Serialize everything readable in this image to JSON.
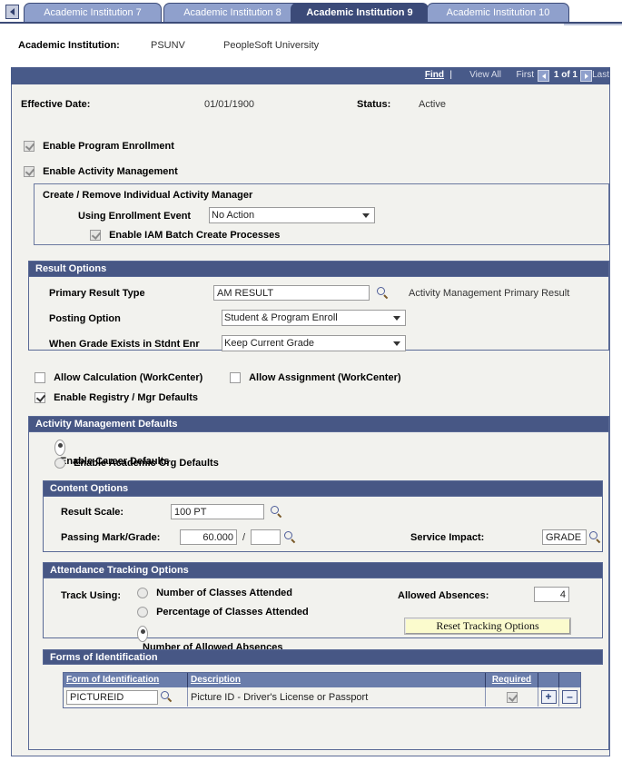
{
  "tabs": {
    "prev_icon": "left-arrow-icon",
    "items": [
      {
        "label": "Academic Institution 7",
        "active": false
      },
      {
        "label": "Academic Institution 8",
        "active": false
      },
      {
        "label": "Academic Institution 9",
        "active": true
      },
      {
        "label": "Academic Institution 10",
        "active": false
      }
    ]
  },
  "institution": {
    "label": "Academic Institution:",
    "code": "PSUNV",
    "name": "PeopleSoft University"
  },
  "nav": {
    "find": "Find",
    "separator": "|",
    "view_all": "View All",
    "first": "First",
    "count": "1 of 1",
    "last": "Last",
    "prev_icon": "prev-arrow-icon",
    "next_icon": "next-arrow-icon"
  },
  "effective": {
    "date_label": "Effective Date:",
    "date_value": "01/01/1900",
    "status_label": "Status:",
    "status_value": "Active"
  },
  "top_checkboxes": [
    {
      "label": "Enable Program Enrollment",
      "checked": true
    },
    {
      "label": "Enable Activity Management",
      "checked": true
    }
  ],
  "iam_box": {
    "title": "Create / Remove Individual Activity Manager",
    "event_label": "Using Enrollment Event",
    "event_value": "No Action",
    "batch_label": "Enable IAM Batch Create Processes",
    "batch_checked": true
  },
  "result_options": {
    "header": "Result Options",
    "primary_result_label": "Primary Result Type",
    "primary_result_value": "AM RESULT",
    "primary_result_desc": "Activity Management Primary Result",
    "posting_label": "Posting Option",
    "posting_value": "Student & Program Enroll",
    "grade_exists_label": "When Grade Exists in Stdnt Enr",
    "grade_exists_value": "Keep Current Grade",
    "lookup_icon": "magnifier-icon"
  },
  "workcenter": [
    {
      "label": "Allow Calculation (WorkCenter)",
      "checked": false
    },
    {
      "label": "Allow Assignment (WorkCenter)",
      "checked": false
    }
  ],
  "registry": {
    "label": "Enable Registry / Mgr Defaults",
    "checked": true
  },
  "am_defaults": {
    "header": "Activity Management Defaults",
    "radios": [
      {
        "label": "Enable Career Defaults",
        "selected": true
      },
      {
        "label": "Enable Academic Org Defaults",
        "selected": false
      }
    ]
  },
  "content_options": {
    "header": "Content Options",
    "result_scale_label": "Result Scale:",
    "result_scale_value": "100 PT",
    "passing_label": "Passing Mark/Grade:",
    "passing_mark": "60.000",
    "passing_separator": "/",
    "passing_grade": "",
    "service_impact_label": "Service Impact:",
    "service_impact_value": "GRADE",
    "lookup_icon": "magnifier-icon"
  },
  "attendance": {
    "header": "Attendance Tracking Options",
    "track_using_label": "Track Using:",
    "options": [
      {
        "label": "Number of Classes Attended",
        "selected": false
      },
      {
        "label": "Percentage of Classes Attended",
        "selected": false
      },
      {
        "label": "Number of Allowed Absences",
        "selected": true
      }
    ],
    "allowed_absences_label": "Allowed Absences:",
    "allowed_absences_value": "4",
    "reset_button": "Reset Tracking Options"
  },
  "forms_of_id": {
    "header": "Forms of Identification",
    "columns": [
      "Form of Identification",
      "Description",
      "Required",
      "",
      ""
    ],
    "rows": [
      {
        "code": "PICTUREID",
        "description": "Picture ID - Driver's License or Passport",
        "required": true,
        "add_label": "+",
        "remove_label": "–"
      }
    ],
    "lookup_icon": "magnifier-icon"
  },
  "colors": {
    "tab_active": "#3b4a78",
    "tab_inactive": "#8fa0cc",
    "section_header": "#475785",
    "navbar": "#485a89",
    "panel_bg": "#f2f2ee",
    "grid_header": "#6a7dab",
    "button_yellow": "#fbfbcd"
  }
}
